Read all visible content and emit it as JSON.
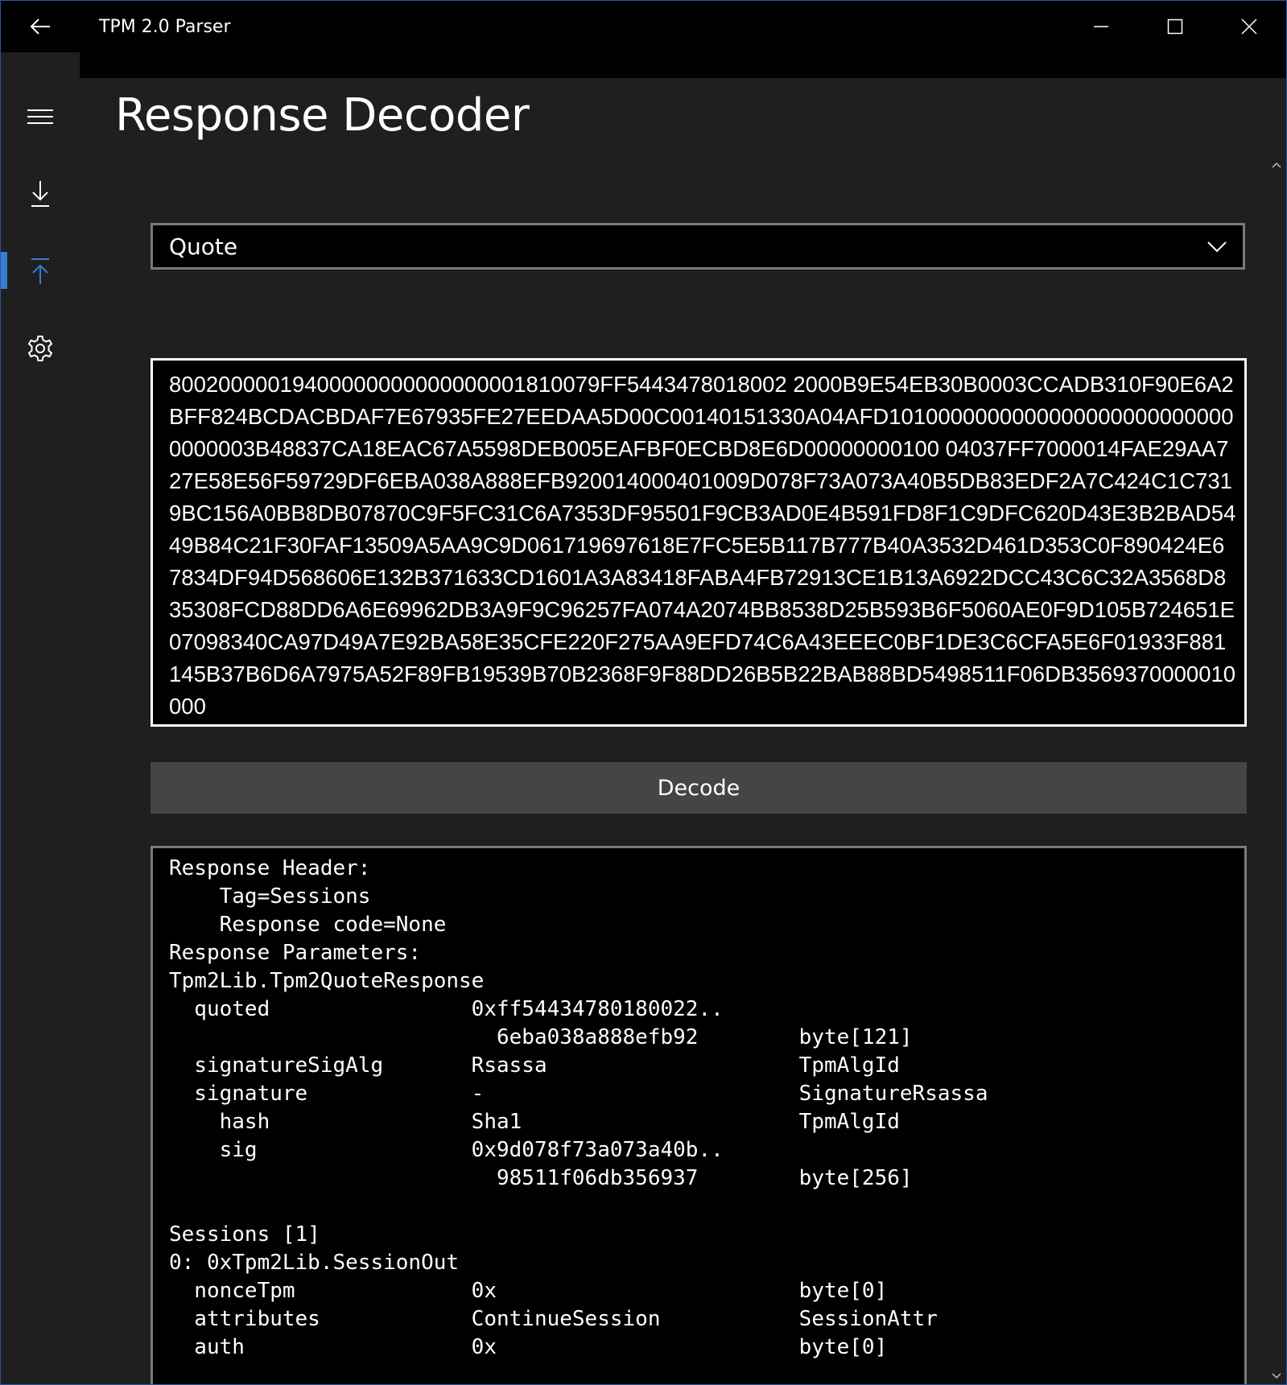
{
  "window": {
    "title": "TPM 2.0 Parser",
    "back_icon": "back-arrow-icon",
    "minimize_icon": "minimize-icon",
    "maximize_icon": "maximize-icon",
    "close_icon": "close-icon"
  },
  "nav": {
    "items": [
      {
        "name": "hamburger-menu",
        "icon": "hamburger-icon"
      },
      {
        "name": "command-decoder",
        "icon": "download-arrow-icon"
      },
      {
        "name": "response-decoder",
        "icon": "upload-arrow-icon",
        "selected": true
      },
      {
        "name": "settings",
        "icon": "gear-icon"
      }
    ],
    "accent": "#3a7bd5"
  },
  "page": {
    "title": "Response Decoder"
  },
  "command_select": {
    "value": "Quote"
  },
  "hex_input": {
    "value": "80020000019400000000000000001810079FF5443478018002 2000B9E54EB30B0003CCADB310F90E6A2BFF824BCDACBDAF7E67935FE27EEDAA5D00C00140151330A04AFD10100000000000000000000000000000003B48837CA18EAC67A5598DEB005EAFBF0ECBD8E6D00000000100 04037FF7000014FAE29AA727E58E56F59729DF6EBA038A888EFB920014000401009D078F73A073A40B5DB83EDF2A7C424C1C7319BC156A0BB8DB07870C9F5FC31C6A7353DF95501F9CB3AD0E4B591FD8F1C9DFC620D43E3B2BAD5449B84C21F30FAF13509A5AA9C9D061719697618E7FC5E5B117B777B40A3532D461D353C0F890424E67834DF94D568606E132B371633CD1601A3A83418FABA4FB72913CE1B13A6922DCC43C6C32A3568D835308FCD88DD6A6E69962DB3A9F9C96257FA074A2074BB8538D25B593B6F5060AE0F9D105B724651E07098340CA97D49A7E92BA58E35CFE220F275AA9EFD74C6A43EEEC0BF1DE3C6CFA5E6F01933F881145B37B6D6A7975A52F89FB19539B70B2368F9F88DD26B5B22BAB88BD5498511F06DB3569370000010000"
  },
  "decode_button": {
    "label": "Decode"
  },
  "output": {
    "text": "Response Header:\n    Tag=Sessions\n    Response code=None\nResponse Parameters:\nTpm2Lib.Tpm2QuoteResponse\n  quoted                0xff54434780180022..\n                          6eba038a888efb92        byte[121]\n  signatureSigAlg       Rsassa                    TpmAlgId\n  signature             -                         SignatureRsassa\n    hash                Sha1                      TpmAlgId\n    sig                 0x9d078f73a073a40b..\n                          98511f06db356937        byte[256]\n\nSessions [1]\n0: 0xTpm2Lib.SessionOut\n  nonceTpm              0x                        byte[0]\n  attributes            ContinueSession           SessionAttr\n  auth                  0x                        byte[0]"
  },
  "scrollbar": {
    "up_icon": "scroll-up-arrow-icon",
    "down_icon": "scroll-down-arrow-icon"
  }
}
